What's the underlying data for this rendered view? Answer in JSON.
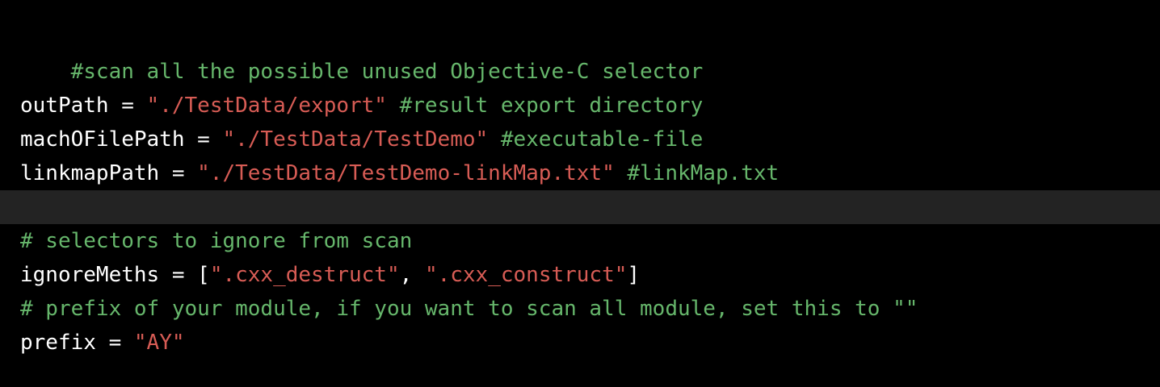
{
  "code": {
    "lines": [
      [
        {
          "t": "comment",
          "text": "#scan all the possible unused Objective-C selector"
        }
      ],
      [],
      [
        {
          "t": "plain",
          "text": "outPath = "
        },
        {
          "t": "string",
          "text": "\"./TestData/export\""
        },
        {
          "t": "plain",
          "text": " "
        },
        {
          "t": "comment",
          "text": "#result export directory"
        }
      ],
      [
        {
          "t": "plain",
          "text": "machOFilePath = "
        },
        {
          "t": "string",
          "text": "\"./TestData/TestDemo\""
        },
        {
          "t": "plain",
          "text": " "
        },
        {
          "t": "comment",
          "text": "#executable-file"
        }
      ],
      [
        {
          "t": "plain",
          "text": "linkmapPath = "
        },
        {
          "t": "string",
          "text": "\"./TestData/TestDemo-linkMap.txt\""
        },
        {
          "t": "plain",
          "text": " "
        },
        {
          "t": "comment",
          "text": "#linkMap.txt"
        }
      ],
      [],
      [
        {
          "t": "comment",
          "text": "# selectors to ignore from scan"
        }
      ],
      [
        {
          "t": "plain",
          "text": "ignoreMeths = ["
        },
        {
          "t": "string",
          "text": "\".cxx_destruct\""
        },
        {
          "t": "plain",
          "text": ", "
        },
        {
          "t": "string",
          "text": "\".cxx_construct\""
        },
        {
          "t": "plain",
          "text": "]"
        }
      ],
      [
        {
          "t": "comment",
          "text": "# prefix of your module, if you want to scan all module, set this to \"\""
        }
      ],
      [
        {
          "t": "plain",
          "text": "prefix = "
        },
        {
          "t": "string",
          "text": "\"AY\""
        }
      ]
    ],
    "highlighted_line": 5
  },
  "colors": {
    "background": "#000000",
    "highlight": "#232323",
    "plain": "#ffffff",
    "comment": "#66b66b",
    "string": "#d75c55"
  }
}
